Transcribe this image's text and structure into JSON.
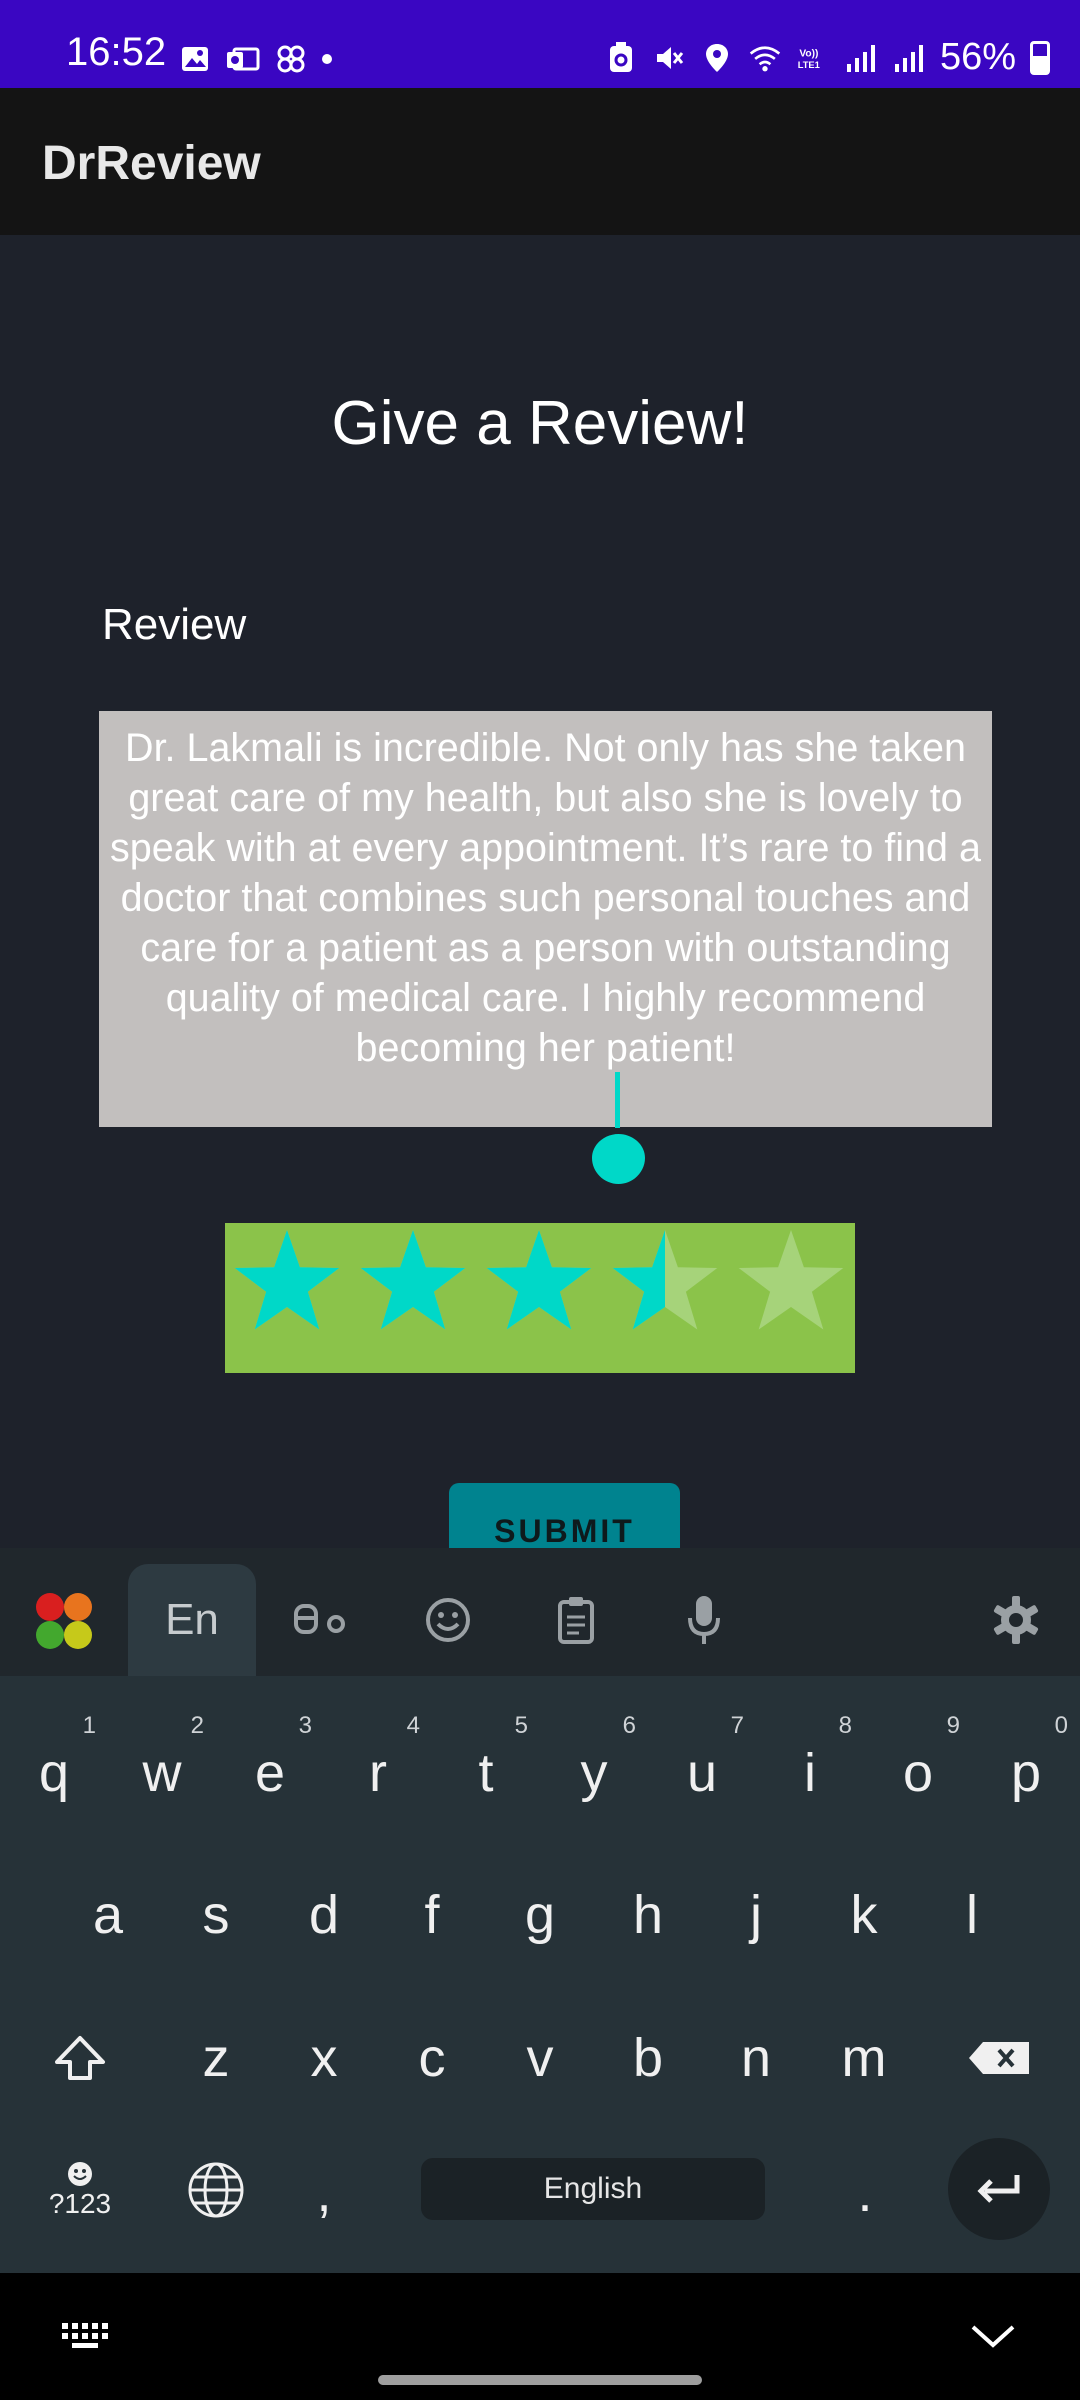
{
  "status_bar": {
    "time": "16:52",
    "battery": "56%",
    "battery_level": 0.56,
    "background_color": "#3a06c2"
  },
  "app_bar": {
    "title": "DrReview"
  },
  "main": {
    "page_title": "Give a Review!",
    "section_label": "Review",
    "review_text": "Dr. Lakmali is incredible. Not only has she taken great care of my health, but also she is lovely to speak with at every appointment. It’s rare to find a doctor that combines such personal touches and care for a patient as a person with outstanding quality of medical care. I highly recommend becoming her patient!",
    "rating": {
      "value": 3.5,
      "max": 5,
      "filled_color": "#00d8c8",
      "empty_color": "#a6d37a",
      "bar_color": "#8bc34a"
    },
    "submit_label": "SUBMIT",
    "accent_color": "#00838f"
  },
  "keyboard": {
    "toolbar": {
      "language_tab": "En",
      "icons": [
        "keyboard-apps-icon",
        "translate-icon",
        "emoji-icon",
        "clipboard-icon",
        "microphone-icon",
        "settings-icon"
      ]
    },
    "row1": [
      {
        "letter": "q",
        "num": "1"
      },
      {
        "letter": "w",
        "num": "2"
      },
      {
        "letter": "e",
        "num": "3"
      },
      {
        "letter": "r",
        "num": "4"
      },
      {
        "letter": "t",
        "num": "5"
      },
      {
        "letter": "y",
        "num": "6"
      },
      {
        "letter": "u",
        "num": "7"
      },
      {
        "letter": "i",
        "num": "8"
      },
      {
        "letter": "o",
        "num": "9"
      },
      {
        "letter": "p",
        "num": "0"
      }
    ],
    "row2": [
      "a",
      "s",
      "d",
      "f",
      "g",
      "h",
      "j",
      "k",
      "l"
    ],
    "row3": [
      "z",
      "x",
      "c",
      "v",
      "b",
      "n",
      "m"
    ],
    "symbols_label": "?123",
    "comma": ",",
    "space_label": "English",
    "period": "."
  }
}
